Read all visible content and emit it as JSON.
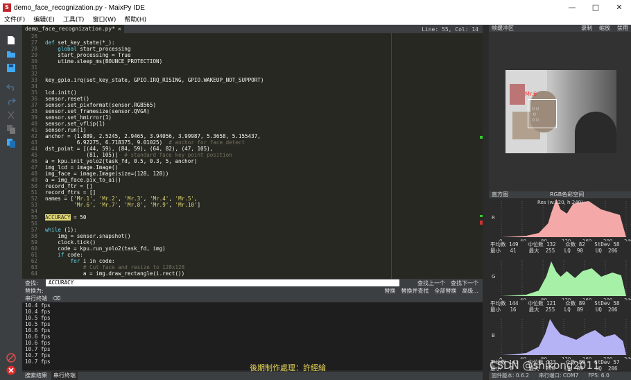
{
  "window": {
    "title": "demo_face_recognization.py - MaixPy IDE",
    "controls": [
      "—",
      "□",
      "✕"
    ]
  },
  "menu": [
    "文件(F)",
    "编辑(E)",
    "工具(T)",
    "窗口(W)",
    "帮助(H)"
  ],
  "editor": {
    "tab": "demo_face_recognization.py*",
    "tab_close": "✕",
    "cursor": "Line: 55, Col: 14",
    "first_line": 26,
    "lines": [
      "",
      "def set_key_state(*_):",
      "    global start_processing",
      "    start_processing = True",
      "    utime.sleep_ms(BOUNCE_PROTECTION)",
      "",
      "",
      "key_gpio.irq(set_key_state, GPIO.IRQ_RISING, GPIO.WAKEUP_NOT_SUPPORT)",
      "",
      "lcd.init()",
      "sensor.reset()",
      "sensor.set_pixformat(sensor.RGB565)",
      "sensor.set_framesize(sensor.QVGA)",
      "sensor.set_hmirror(1)",
      "sensor.set_vflip(1)",
      "sensor.run(1)",
      "anchor = (1.889, 2.5245, 2.9465, 3.94056, 3.99987, 5.3658, 5.155437,",
      "          6.92275, 6.718375, 9.01025)  # anchor for face detect",
      "dst_point = [(44, 59), (84, 59), (64, 82), (47, 105),",
      "             (81, 105)]  # standard face key point position",
      "a = kpu.init_yolo2(task_fd, 0.5, 0.3, 5, anchor)",
      "img_lcd = image.Image()",
      "img_face = image.Image(size=(128, 128))",
      "a = img_face.pix_to_ai()",
      "record_ftr = []",
      "record_ftrs = []",
      "names = ['Mr.1', 'Mr.2', 'Mr.3', 'Mr.4', 'Mr.5',",
      "         'Mr.6', 'Mr.7', 'Mr.8', 'Mr.9', 'Mr.10']",
      "",
      "ACCURACY = 50",
      "",
      "while (1):",
      "    img = sensor.snapshot()",
      "    clock.tick()",
      "    code = kpu.run_yolo2(task_fd, img)",
      "    if code:",
      "        for i in code:",
      "            # Cut face and resize to 128x128",
      "            a = img.draw_rectangle(i.rect())"
    ]
  },
  "find": {
    "find_label": "查找:",
    "find_value": "ACCURACY",
    "replace_label": "替换为:",
    "prev": "查找上一个",
    "next": "查找下一个",
    "replace": "替换",
    "replace_find": "替换并查找",
    "replace_all": "全部替换",
    "advanced": "高级..."
  },
  "serial": {
    "title": "串行终端",
    "lines": [
      "10.4 fps",
      "10.4 fps",
      "10.5 fps",
      "10.5 fps",
      "10.6 fps",
      "10.6 fps",
      "10.6 fps",
      "10.7 fps",
      "10.7 fps",
      "10.7 fps"
    ]
  },
  "bottom_tabs": [
    "搜索结果",
    "串行终端"
  ],
  "overlay_text": "後期制作處理：許經綸",
  "frame_buffer": {
    "title": "帧缓冲区",
    "record": "录制",
    "zoom": "缩放",
    "disable": "禁用",
    "face_label": "Mr.6"
  },
  "histogram": {
    "title": "直方图",
    "mode": "RGB色彩空间",
    "res": "Res (w:320, h:240)",
    "ticks": [
      "0",
      "40",
      "80",
      "120",
      "160",
      "200",
      "240"
    ],
    "channels": [
      {
        "name": "R",
        "color": "#f4a8a8",
        "stats": "平均数 149   中位数 132   众数 82   StDev 58\n最小   41    最大  255   LQ  90    UQ  206"
      },
      {
        "name": "G",
        "color": "#a7f0a7",
        "stats": "平均数 144   中位数 121   众数 89   StDev 58\n最小   16    最大  255   LQ  89    UQ  206"
      },
      {
        "name": "B",
        "color": "#b5b3f5",
        "stats": "平均数 143   中位数 123   众数 89   StDev 57\n最小   8     最大  255   LQ  89    UQ  206"
      }
    ]
  },
  "status": {
    "firmware": "固件版本: 0.6.2",
    "port": "串行端口: COM7",
    "fps": "FPS: 6.0"
  },
  "watermark": "CSDN @shikong2011"
}
